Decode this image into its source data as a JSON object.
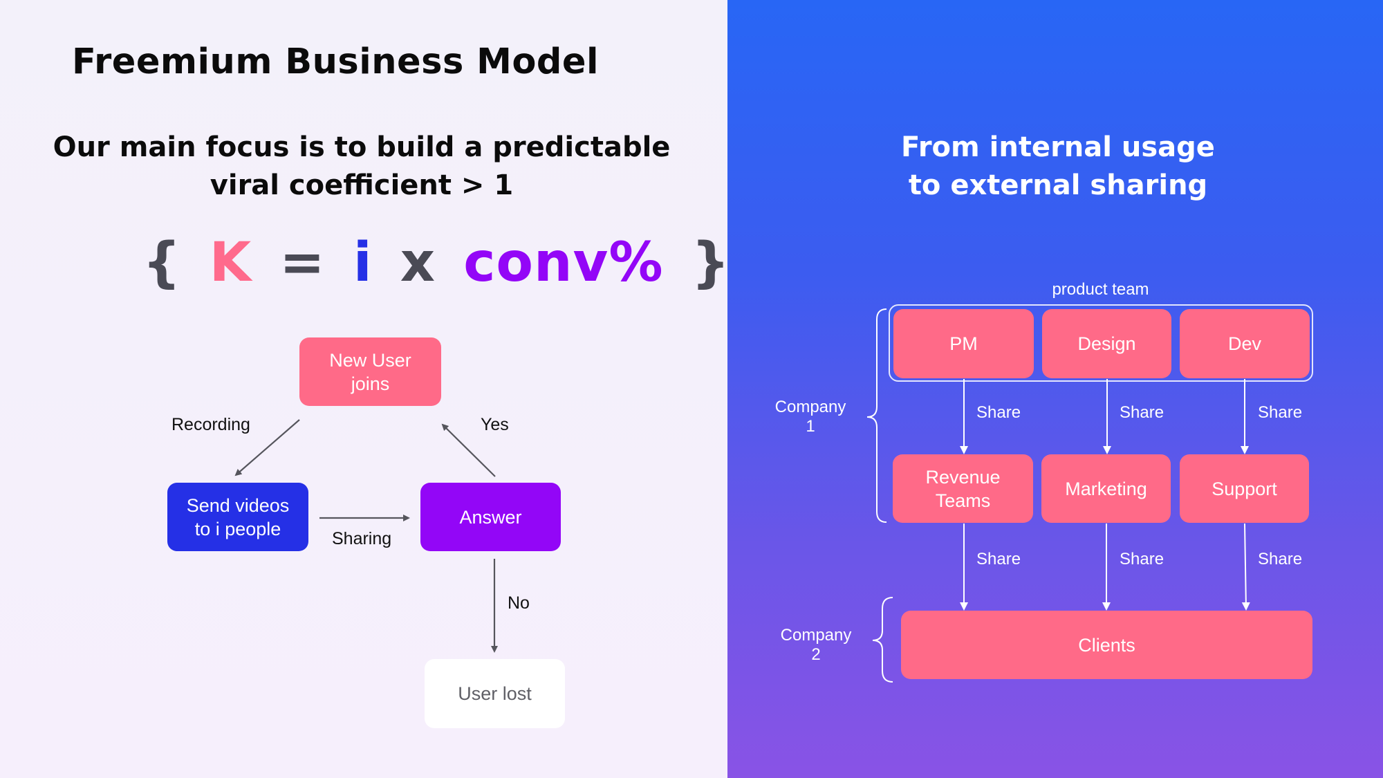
{
  "colors": {
    "pink": "#ff6a88",
    "blue": "#2530e6",
    "purple": "#9306f7",
    "formula_k": "#ff6a8c",
    "formula_i": "#2530e6",
    "formula_conv": "#9306f7",
    "formula_neutral": "#4a4a55",
    "left_background": "#f3f1fa",
    "right_background_top": "#2866f5",
    "right_background_bottom": "#8953e6"
  },
  "left": {
    "title": "Freemium Business Model",
    "subtitle_line1": "Our main focus is to build a predictable",
    "subtitle_line2": "viral coefficient > 1",
    "formula": {
      "open_brace": "{",
      "k": "K",
      "equals": "=",
      "i": "i",
      "times": "x",
      "conv": "conv%",
      "close_brace": "}"
    },
    "flow": {
      "nodes": {
        "new_user_line1": "New User",
        "new_user_line2": "joins",
        "send_videos_line1": "Send videos",
        "send_videos_line2": "to i people",
        "answer": "Answer",
        "user_lost": "User lost"
      },
      "edges": {
        "recording": "Recording",
        "sharing": "Sharing",
        "yes": "Yes",
        "no": "No"
      }
    }
  },
  "right": {
    "title_line1": "From internal usage",
    "title_line2": "to external sharing",
    "product_team_label": "product team",
    "company1_line1": "Company",
    "company1_line2": "1",
    "company2_line1": "Company",
    "company2_line2": "2",
    "top_row": [
      "PM",
      "Design",
      "Dev"
    ],
    "middle_row": [
      {
        "line1": "Revenue",
        "line2": "Teams"
      },
      {
        "line1": "Marketing",
        "line2": ""
      },
      {
        "line1": "Support",
        "line2": ""
      }
    ],
    "bottom": "Clients",
    "share_labels_upper": [
      "Share",
      "Share",
      "Share"
    ],
    "share_labels_lower": [
      "Share",
      "Share",
      "Share"
    ]
  }
}
